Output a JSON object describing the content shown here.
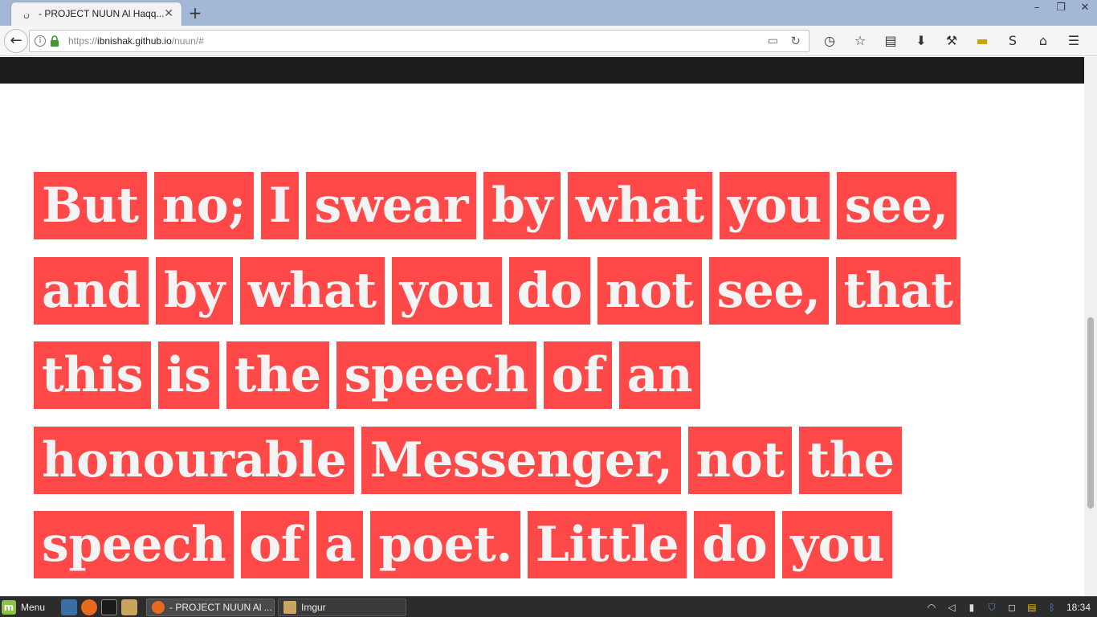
{
  "browser": {
    "tab": {
      "title": "- PROJECT NUUN Al Haqq..."
    },
    "url": {
      "scheme": "https://",
      "host": "ibnishak.github.io",
      "path": "/nuun/#"
    }
  },
  "page": {
    "lines": [
      [
        "But",
        "no;",
        "I",
        "swear",
        "by",
        "what",
        "you",
        "see,"
      ],
      [
        "and",
        "by",
        "what",
        "you",
        "do",
        "not",
        "see,",
        "that"
      ],
      [
        "this",
        "is",
        "the",
        "speech",
        "of",
        "an"
      ],
      [
        "honourable",
        "Messenger,",
        "not",
        "the"
      ],
      [
        "speech",
        "of",
        "a",
        "poet.",
        "Little",
        "do",
        "you"
      ]
    ],
    "colors": {
      "word_bg": "#ff4848",
      "word_text": "#f4f4f4",
      "header_bg": "#1c1c1c"
    }
  },
  "taskbar": {
    "menu_label": "Menu",
    "tasks": [
      "- PROJECT NUUN Al ...",
      "Imgur"
    ],
    "clock": "18:34"
  }
}
